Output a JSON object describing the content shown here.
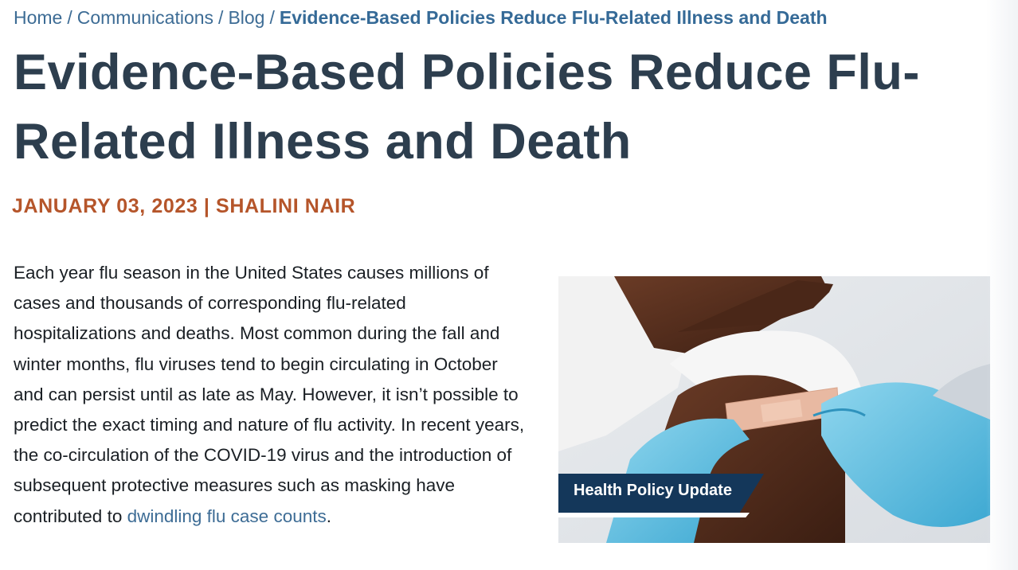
{
  "breadcrumb": {
    "items": [
      "Home",
      "Communications",
      "Blog"
    ],
    "separator": "/",
    "current": "Evidence-Based Policies Reduce Flu-Related Illness and Death"
  },
  "article": {
    "title": "Evidence-Based Policies Reduce Flu-Related Illness and Death",
    "date": "JANUARY 03, 2023",
    "byline_separator": "|",
    "author": "SHALINI NAIR",
    "body_text": "Each year flu season in the United States causes millions of cases and thousands of corresponding flu-related hospitalizations and deaths. Most common during the fall and winter months, flu viruses tend to begin circulating in October and can persist until as late as May. However, it isn’t possible to predict the exact timing and nature of flu activity. In recent years, the co-circulation of the COVID-19 virus and the introduction of subsequent protective measures such as masking have contributed to ",
    "body_link": "dwindling flu case counts",
    "body_end": "."
  },
  "hero_image": {
    "banner_label": "Health Policy Update"
  },
  "colors": {
    "link": "#3d6c95",
    "title": "#2d3e4e",
    "byline": "#b5552a",
    "banner": "#14375a",
    "glove": "#5cbfe0"
  }
}
